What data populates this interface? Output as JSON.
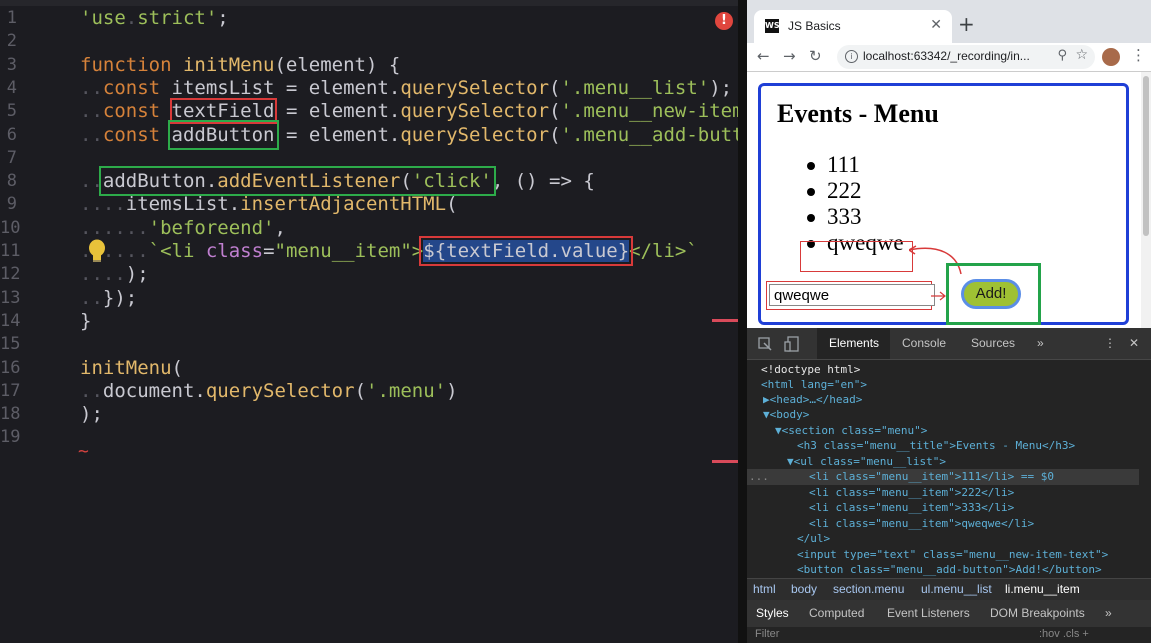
{
  "editor": {
    "lines": [
      {
        "n": "1",
        "html": "<span class='str'>'use</span><span class='dot'>.</span><span class='str'>strict'</span>;"
      },
      {
        "n": "2",
        "html": ""
      },
      {
        "n": "3",
        "html": "<span class='kw'>function</span> <span class='fn'>initMenu</span>(element) {"
      },
      {
        "n": "4",
        "html": "<span class='dot'>..</span><span class='kw'>const</span> itemsList = element.<span class='fn'>querySelector</span>(<span class='str'>'.menu__list'</span>);"
      },
      {
        "n": "5",
        "html": "<span class='dot'>..</span><span class='kw'>const</span> <span class='box-red'>textField</span> = element.<span class='fn'>querySelector</span>(<span class='str'>'.menu__new-item</span>"
      },
      {
        "n": "6",
        "html": "<span class='dot'>..</span><span class='kw'>const</span> <span class='box-green'>addButton</span> = element.<span class='fn'>querySelector</span>(<span class='str'>'.menu__add-butt</span>"
      },
      {
        "n": "7",
        "html": ""
      },
      {
        "n": "8",
        "html": "<span class='dot'>..</span><span class='box-green'>addButton.<span class='fn'>addEventListener</span>(<span class='str'>'click'</span></span>, () => {"
      },
      {
        "n": "9",
        "html": "<span class='dot'>....</span>itemsList.<span class='fn'>insertAdjacentHTML</span>("
      },
      {
        "n": "10",
        "html": "<span class='dot'>......</span><span class='str'>'beforeend'</span>,"
      },
      {
        "n": "11",
        "html": "<span class='dot'>......</span><span class='str'>`&lt;li</span> <span class='cls'>class</span>=<span class='str'>\"menu__item\"</span><span class='str'>&gt;</span><span class='sel'>${textField.value}</span><span class='str'>&lt;/li&gt;`</span>"
      },
      {
        "n": "12",
        "html": "<span class='dot'>....</span>);"
      },
      {
        "n": "13",
        "html": "<span class='dot'>..</span>});"
      },
      {
        "n": "14",
        "html": "}"
      },
      {
        "n": "15",
        "html": ""
      },
      {
        "n": "16",
        "html": "<span class='fn'>initMenu</span>("
      },
      {
        "n": "17",
        "html": "<span class='dot'>..</span>document.<span class='fn'>querySelector</span>(<span class='str'>'.menu'</span>)"
      },
      {
        "n": "18",
        "html": ");"
      },
      {
        "n": "19",
        "html": ""
      }
    ]
  },
  "browser": {
    "tab_title": "JS Basics",
    "favicon_text": "WS",
    "url": "localhost:63342/_recording/in...",
    "page": {
      "heading": "Events - Menu",
      "items": [
        "111",
        "222",
        "333",
        "qweqwe"
      ],
      "input_value": "qweqwe",
      "button_label": "Add!"
    }
  },
  "devtools": {
    "tabs": [
      "Elements",
      "Console",
      "Sources"
    ],
    "more": "»",
    "dom_lines": [
      "<!doctype html>",
      "<html lang=\"en\">",
      "▶<head>…</head>",
      "▼<body>",
      "▼<section class=\"menu\">",
      "<h3 class=\"menu__title\">Events - Menu</h3>",
      "▼<ul class=\"menu__list\">",
      "<li class=\"menu__item\">111</li> == $0",
      "<li class=\"menu__item\">222</li>",
      "<li class=\"menu__item\">333</li>",
      "<li class=\"menu__item\">qweqwe</li>",
      "</ul>",
      "<input type=\"text\" class=\"menu__new-item-text\">",
      "<button class=\"menu__add-button\">Add!</button>"
    ],
    "breadcrumbs": [
      "html",
      "body",
      "section.menu",
      "ul.menu__list",
      "li.menu__item"
    ],
    "style_tabs": [
      "Styles",
      "Computed",
      "Event Listeners",
      "DOM Breakpoints",
      "»"
    ],
    "filter_placeholder": "Filter",
    "filter_right": ":hov .cls +"
  }
}
